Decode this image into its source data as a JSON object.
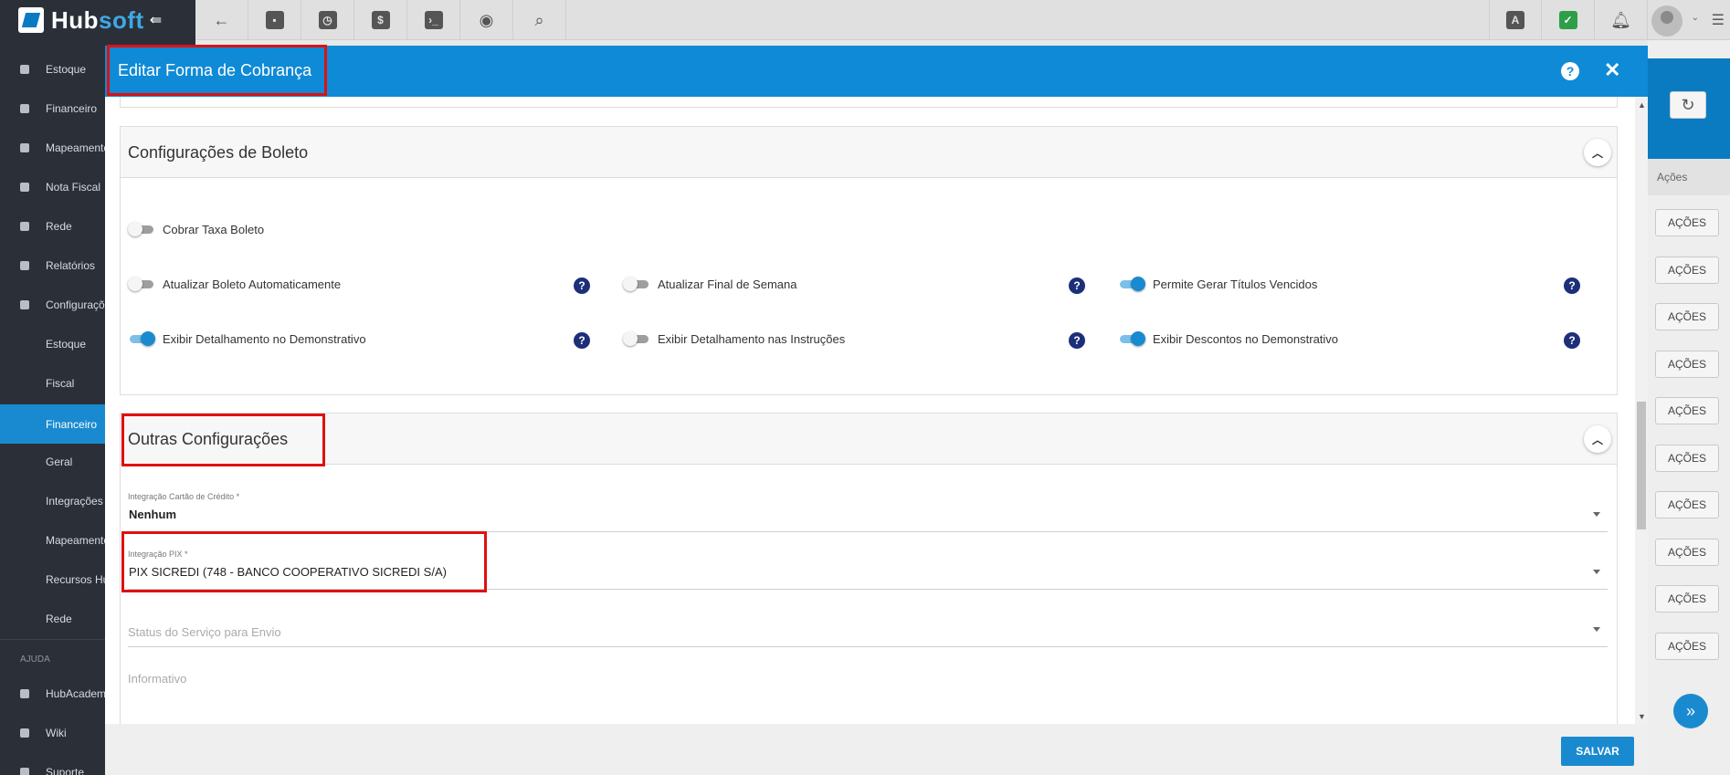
{
  "topbar": {
    "logo_prefix": "Hub",
    "logo_suffix": "soft",
    "collapse_glyph": "⇚",
    "buttons": [
      "back-arrow-icon",
      "contact-card-icon",
      "calendar-clock-icon",
      "dollar-icon",
      "terminal-icon",
      "eye-icon",
      "search-icon"
    ],
    "right_icons": [
      "pdf-icon",
      "check-chat-icon",
      "bell-icon"
    ]
  },
  "sidebar": {
    "items": [
      {
        "label": "Estoque"
      },
      {
        "label": "Financeiro"
      },
      {
        "label": "Mapeamento"
      },
      {
        "label": "Nota Fiscal"
      },
      {
        "label": "Rede"
      },
      {
        "label": "Relatórios"
      },
      {
        "label": "Configuraçõ"
      }
    ],
    "subitems": [
      {
        "label": "Estoque"
      },
      {
        "label": "Fiscal"
      },
      {
        "label": "Financeiro"
      },
      {
        "label": "Geral"
      },
      {
        "label": "Integrações"
      },
      {
        "label": "Mapeamento"
      },
      {
        "label": "Recursos Hu"
      },
      {
        "label": "Rede"
      }
    ],
    "help_section": "AJUDA",
    "help_items": [
      {
        "label": "HubAcadem"
      },
      {
        "label": "Wiki"
      },
      {
        "label": "Suporte"
      }
    ]
  },
  "background_page": {
    "column_header": "Ações",
    "action_label": "AÇÕES",
    "action_count": 10
  },
  "modal": {
    "title": "Editar Forma de Cobrança",
    "save_label": "SALVAR",
    "boleto_panel": {
      "title": "Configurações de Boleto",
      "toggles": [
        {
          "label": "Cobrar Taxa Boleto",
          "on": false,
          "help": false
        },
        {
          "label": "Atualizar Boleto Automaticamente",
          "on": false,
          "help": true
        },
        {
          "label": "Atualizar Final de Semana",
          "on": false,
          "help": true
        },
        {
          "label": "Permite Gerar Títulos Vencidos",
          "on": true,
          "help": true
        },
        {
          "label": "Exibir Detalhamento no Demonstrativo",
          "on": true,
          "help": true
        },
        {
          "label": "Exibir Detalhamento nas Instruções",
          "on": false,
          "help": true
        },
        {
          "label": "Exibir Descontos no Demonstrativo",
          "on": true,
          "help": true
        }
      ]
    },
    "outras_panel": {
      "title": "Outras Configurações",
      "fields": {
        "cartao": {
          "label": "Integração Cartão de Crédito *",
          "value": "Nenhum"
        },
        "pix": {
          "label": "Integração PIX *",
          "value": "PIX SICREDI (748 - BANCO COOPERATIVO SICREDI S/A)"
        },
        "status": {
          "placeholder": "Status do Serviço para Envio"
        },
        "informativo": {
          "placeholder": "Informativo"
        }
      }
    }
  },
  "colors": {
    "accent": "#0f8ad6",
    "sidebar_bg": "#2b3038",
    "highlight": "#e01010",
    "help_icon": "#1c2f78"
  }
}
